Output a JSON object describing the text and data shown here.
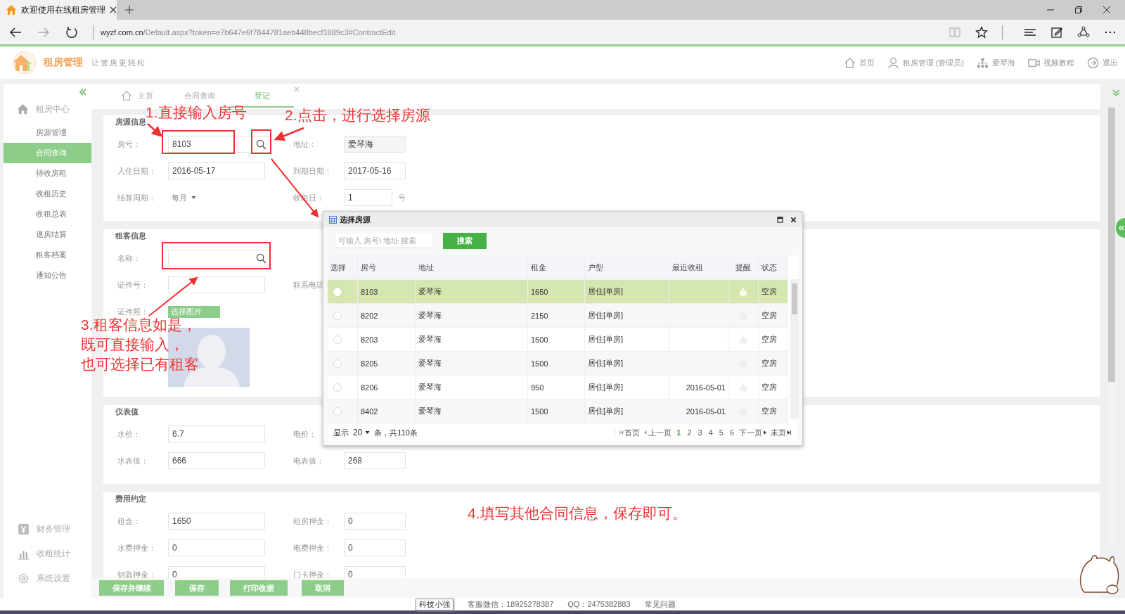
{
  "browser": {
    "tab_title": "欢迎使用在线租房管理",
    "url_host": "wyzf.com.cn",
    "url_path": "/Default.aspx?token=e7b647e6f7844781aeb448becf1889c3#ContractEdit"
  },
  "header": {
    "app_name": "租房管理",
    "slogan": "让管房更轻松",
    "nav": [
      {
        "label": "首页",
        "kind": "home"
      },
      {
        "label": "租房管理 (管理员)",
        "kind": "user"
      },
      {
        "label": "爱琴海",
        "kind": "org"
      },
      {
        "label": "视频教程",
        "kind": "video"
      },
      {
        "label": "退出",
        "kind": "logout"
      }
    ]
  },
  "sidebar": {
    "group": "租房中心",
    "items": [
      {
        "label": "房源管理",
        "selected": false
      },
      {
        "label": "合同查询",
        "selected": true
      },
      {
        "label": "待收房租",
        "selected": false
      },
      {
        "label": "收租历史",
        "selected": false
      },
      {
        "label": "收租总表",
        "selected": false
      },
      {
        "label": "退房结算",
        "selected": false
      },
      {
        "label": "租客档案",
        "selected": false
      },
      {
        "label": "通知公告",
        "selected": false
      }
    ],
    "bottom_items": [
      {
        "label": "财务管理",
        "kind": "finance"
      },
      {
        "label": "收租统计",
        "kind": "stats"
      },
      {
        "label": "系统设置",
        "kind": "settings"
      }
    ]
  },
  "tabs": [
    {
      "label": "主页",
      "kind": "home",
      "selected": false,
      "closable": false
    },
    {
      "label": "合同查询",
      "kind": "plain",
      "selected": false,
      "closable": false
    },
    {
      "label": "登记",
      "kind": "plain",
      "selected": true,
      "closable": true
    }
  ],
  "sections": [
    {
      "title": "房源信息",
      "rows": [
        {
          "fields": [
            {
              "label": "房号：",
              "kind": "search",
              "value": "8103"
            },
            {
              "label": "地址：",
              "kind": "readonly",
              "value": "爱琴海"
            }
          ]
        },
        {
          "fields": [
            {
              "label": "入住日期：",
              "kind": "text",
              "value": "2016-05-17"
            },
            {
              "label": "到期日期：",
              "kind": "text",
              "value": "2017-05-16"
            }
          ]
        },
        {
          "fields": [
            {
              "label": "结算周期：",
              "kind": "dropdown",
              "value": "每月"
            },
            {
              "label": "收租日：",
              "kind": "text",
              "value": "1",
              "suffix": "号"
            }
          ]
        }
      ]
    },
    {
      "title": "租客信息",
      "rows": [
        {
          "fields": [
            {
              "label": "名称：",
              "kind": "search"
            }
          ]
        },
        {
          "fields": [
            {
              "label": "证件号：",
              "kind": "text"
            },
            {
              "label": "联系电话",
              "kind": "label_only"
            }
          ]
        },
        {
          "fields": [
            {
              "label": "证件照：",
              "kind": "upload",
              "button": "选择图片"
            }
          ]
        }
      ]
    },
    {
      "title": "仪表值",
      "rows": [
        {
          "fields": [
            {
              "label": "水价：",
              "kind": "text",
              "value": "6.7"
            },
            {
              "label": "电价：",
              "kind": "label_only"
            }
          ]
        },
        {
          "fields": [
            {
              "label": "水表值：",
              "kind": "text",
              "value": "666"
            },
            {
              "label": "电表值：",
              "kind": "text",
              "value": "268"
            }
          ]
        }
      ]
    },
    {
      "title": "费用约定",
      "rows": [
        {
          "fields": [
            {
              "label": "租金：",
              "kind": "text",
              "value": "1650"
            },
            {
              "label": "租房押金：",
              "kind": "text",
              "value": "0"
            }
          ]
        },
        {
          "fields": [
            {
              "label": "水费押金：",
              "kind": "text",
              "value": "0"
            },
            {
              "label": "电费押金：",
              "kind": "text",
              "value": "0"
            }
          ]
        },
        {
          "fields": [
            {
              "label": "钥匙押金：",
              "kind": "text",
              "value": "0"
            },
            {
              "label": "门卡押金：",
              "kind": "text",
              "value": "0"
            }
          ]
        }
      ]
    }
  ],
  "buttons": [
    "保存并继续",
    "保存",
    "打印收据",
    "取消"
  ],
  "footer": {
    "tooltip": "科技小强",
    "service": "客服微信：18925278387",
    "qq": "QQ：2475382883",
    "help": "常见问题"
  },
  "dialog": {
    "title": "选择房源",
    "search": {
      "placeholder": "可输入 房号\\ 地址 搜索"
    },
    "search_button": "搜索",
    "columns": [
      "选择",
      "房号",
      "地址",
      "租金",
      "户型",
      "最近收租",
      "提醒",
      "状态"
    ],
    "rows": [
      {
        "selected": true,
        "room": "8103",
        "address": "爱琴海",
        "rent": "1650",
        "type": "居住[单房]",
        "status": "空房"
      },
      {
        "selected": false,
        "room": "8202",
        "address": "爱琴海",
        "rent": "2150",
        "type": "居住[单房]",
        "status": "空房"
      },
      {
        "selected": false,
        "room": "8203",
        "address": "爱琴海",
        "rent": "1500",
        "type": "居住[单房]",
        "status": "空房"
      },
      {
        "selected": false,
        "room": "8205",
        "address": "爱琴海",
        "rent": "1500",
        "type": "居住[单房]",
        "status": "空房"
      },
      {
        "selected": false,
        "room": "8206",
        "address": "爱琴海",
        "rent": "950",
        "type": "居住[单房]",
        "last_collected": "2016-05-01",
        "status": "空房"
      },
      {
        "selected": false,
        "room": "8402",
        "address": "爱琴海",
        "rent": "1500",
        "type": "居住[单房]",
        "last_collected": "2016-05-01",
        "status": "空房"
      }
    ],
    "pager": {
      "show_label": "显示",
      "page_size": "20",
      "total": "条，共110条",
      "first": "首页",
      "prev": "上一页",
      "pages": [
        {
          "label": "1",
          "selected": true
        },
        {
          "label": "2",
          "selected": false
        },
        {
          "label": "3",
          "selected": false
        },
        {
          "label": "4",
          "selected": false
        },
        {
          "label": "5",
          "selected": false
        },
        {
          "label": "6",
          "selected": false
        }
      ],
      "next": "下一页",
      "last": "末页"
    }
  },
  "annotations": [
    {
      "text": "1.直接输入房号"
    },
    {
      "text": "2.点击，进行选择房源"
    },
    {
      "lines": [
        "3.租客信息如是，",
        "既可直接输入，",
        "也可选择已有租客"
      ]
    },
    {
      "text": "4.填写其他合同信息，保存即可。"
    }
  ]
}
